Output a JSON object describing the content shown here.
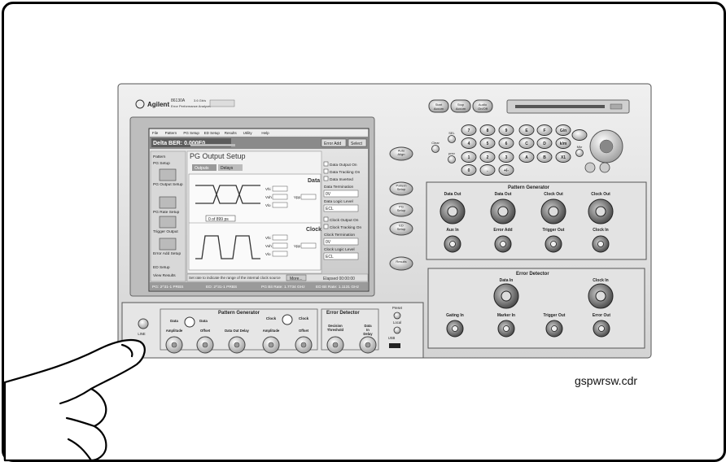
{
  "figure": {
    "filename": "gspwrsw.cdr"
  },
  "instrument": {
    "brand": "Agilent",
    "model": "86130A",
    "model_sub": "3.6 Gb/s",
    "model_desc": "Error Performance Analyzer",
    "menu_items": [
      "File",
      "Pattern",
      "PG Setup",
      "ED Setup",
      "Results",
      "Utility",
      "Help"
    ],
    "status": {
      "delta_ber": "Delta BER: 0.000E0",
      "err_add": "Error Add",
      "select": "Select"
    },
    "left_nav": [
      "Pattern",
      "PG Setup",
      "PG Output Setup",
      "PG Rate Setup",
      "Trigger Output",
      "Error Add Setup",
      "ED Setup",
      "View Results"
    ],
    "panel_title": "PG Output Setup",
    "tabs": [
      "Outputs",
      "Delays"
    ],
    "right_options": [
      "Data Output On",
      "Data Tracking On",
      "Data Inverted",
      "Data Termination",
      "0V",
      "Data Logic Level",
      "ECL",
      "Clock Output On",
      "Clock Tracking On",
      "Clock Termination",
      "0V",
      "Clock Logic Level",
      "ECL"
    ],
    "section_labels": {
      "data": "Data",
      "clock": "Clock"
    },
    "wave_labels": [
      "Vhi",
      "Voh",
      "Vlo",
      "Vpp",
      "Vhi",
      "Voh",
      "Vlo",
      "Vpp"
    ],
    "marker_label": "0 of 899 ps",
    "bottom_status": [
      "PG: 2^31-1 PRBS",
      "ED: 2^31-1 PRBS",
      "PG Bit Rate: 1.7734 GHz",
      "ED Bit Rate: 1.1131 GHz"
    ],
    "footer_hint": "Set rate to indicate the range of the internal clock source",
    "more_button": "More...",
    "elapsed": "Elapsed 00:00:00",
    "side_buttons": [
      "Auto Align",
      "Pattern Setup",
      "PG Setup",
      "ED Setup",
      "Results"
    ],
    "run_buttons": [
      "Start Accum",
      "Stop Accum",
      "Audio On/Off"
    ],
    "keypad": [
      "7",
      "8",
      "9",
      "E",
      "F",
      "G/n",
      "4",
      "5",
      "6",
      "C",
      "D",
      "k/m",
      "1",
      "2",
      "3",
      "A",
      "B",
      "X1",
      "0",
      ".",
      "+/-"
    ],
    "keypad_misc": [
      "Clear",
      "SEL",
      "prev",
      "Mkr"
    ],
    "rear_pattern_generator": {
      "title": "Pattern Generator",
      "row1": [
        "Data Out",
        "Data Out",
        "Clock Out",
        "Clock Out"
      ],
      "row2": [
        "Aux In",
        "Error Add",
        "Trigger Out",
        "Clock In"
      ]
    },
    "rear_error_detector": {
      "title": "Error Detector",
      "top": [
        "Data In",
        "Clock In"
      ],
      "bottom": [
        "Gating In",
        "Marker In",
        "Trigger Out",
        "Error Out"
      ]
    },
    "front_pattern_generator": {
      "title": "Pattern Generator",
      "knobs": [
        "Amplitude",
        "Offset",
        "Data Out Delay",
        "Amplitude",
        "Offset"
      ],
      "toggles": [
        "Data",
        "Data",
        "Clock",
        "Clock"
      ]
    },
    "front_error_detector": {
      "title": "Error Detector",
      "knobs": [
        "Decision Threshold",
        "Data In Delay"
      ]
    },
    "front_misc": [
      "Preset",
      "Local",
      "USB",
      "LINE"
    ]
  }
}
